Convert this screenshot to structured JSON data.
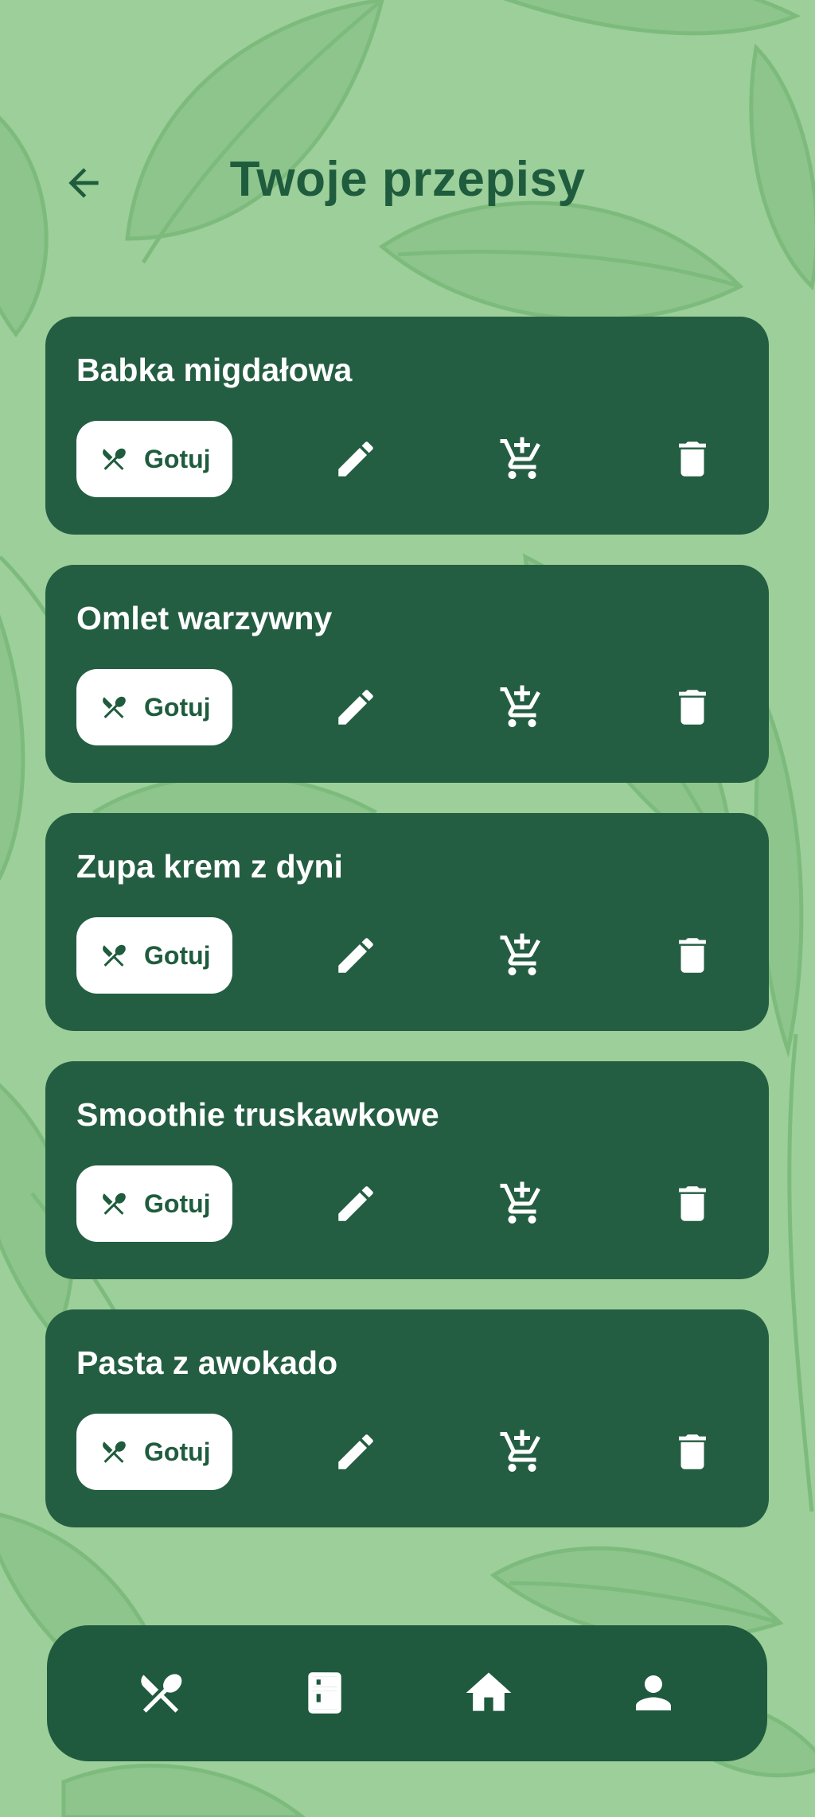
{
  "header": {
    "title": "Twoje przepisy",
    "back_icon": "arrow-left-icon"
  },
  "colors": {
    "background": "#9ccf9a",
    "card": "#245e42",
    "title": "#1f5c3e",
    "nav": "#1f5a3e",
    "button": "#ffffff"
  },
  "recipes": [
    {
      "name": "Babka migdałowa",
      "cook_label": "Gotuj"
    },
    {
      "name": "Omlet warzywny",
      "cook_label": "Gotuj"
    },
    {
      "name": "Zupa krem z dyni",
      "cook_label": "Gotuj"
    },
    {
      "name": "Smoothie truskawkowe",
      "cook_label": "Gotuj"
    },
    {
      "name": "Pasta z awokado",
      "cook_label": "Gotuj"
    }
  ],
  "card_actions": {
    "cook_icon": "fork-spoon-icon",
    "edit_icon": "pencil-icon",
    "cart_icon": "add-to-cart-icon",
    "delete_icon": "trash-icon"
  },
  "bottom_nav": {
    "items": [
      {
        "icon": "fork-spoon-icon"
      },
      {
        "icon": "fridge-icon"
      },
      {
        "icon": "home-icon"
      },
      {
        "icon": "person-icon"
      }
    ]
  }
}
